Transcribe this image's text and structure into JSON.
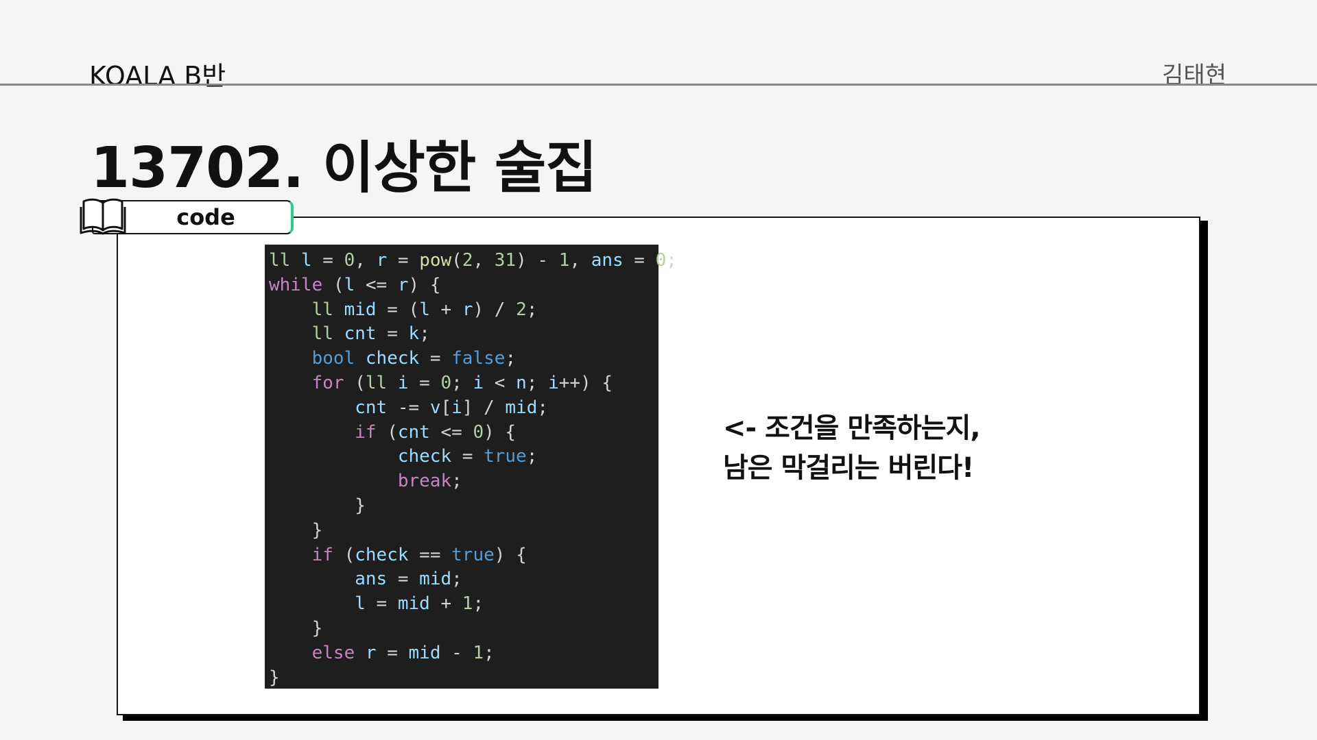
{
  "header": {
    "left": "KOALA B반",
    "right": "김태현"
  },
  "title": "13702. 이상한 술집",
  "tab": {
    "icon": "book-icon",
    "label": "code"
  },
  "code_lines": [
    "ll l = 0, r = pow(2, 31) - 1, ans = 0;",
    "while (l <= r) {",
    "    ll mid = (l + r) / 2;",
    "    ll cnt = k;",
    "    bool check = false;",
    "    for (ll i = 0; i < n; i++) {",
    "        cnt -= v[i] / mid;",
    "        if (cnt <= 0) {",
    "            check = true;",
    "            break;",
    "        }",
    "    }",
    "    if (check == true) {",
    "        ans = mid;",
    "        l = mid + 1;",
    "    }",
    "    else r = mid - 1;",
    "}"
  ],
  "description": {
    "line1": "<- 조건을 만족하는지,",
    "line2": "남은 막걸리는 버린다!"
  },
  "colors": {
    "code_bg": "#1e1e1e",
    "keyword": "#c586c0",
    "type": "#569cd6",
    "identifier": "#9cdcfe",
    "number": "#b5cea8",
    "tab_accent": "#2ecc8a"
  }
}
